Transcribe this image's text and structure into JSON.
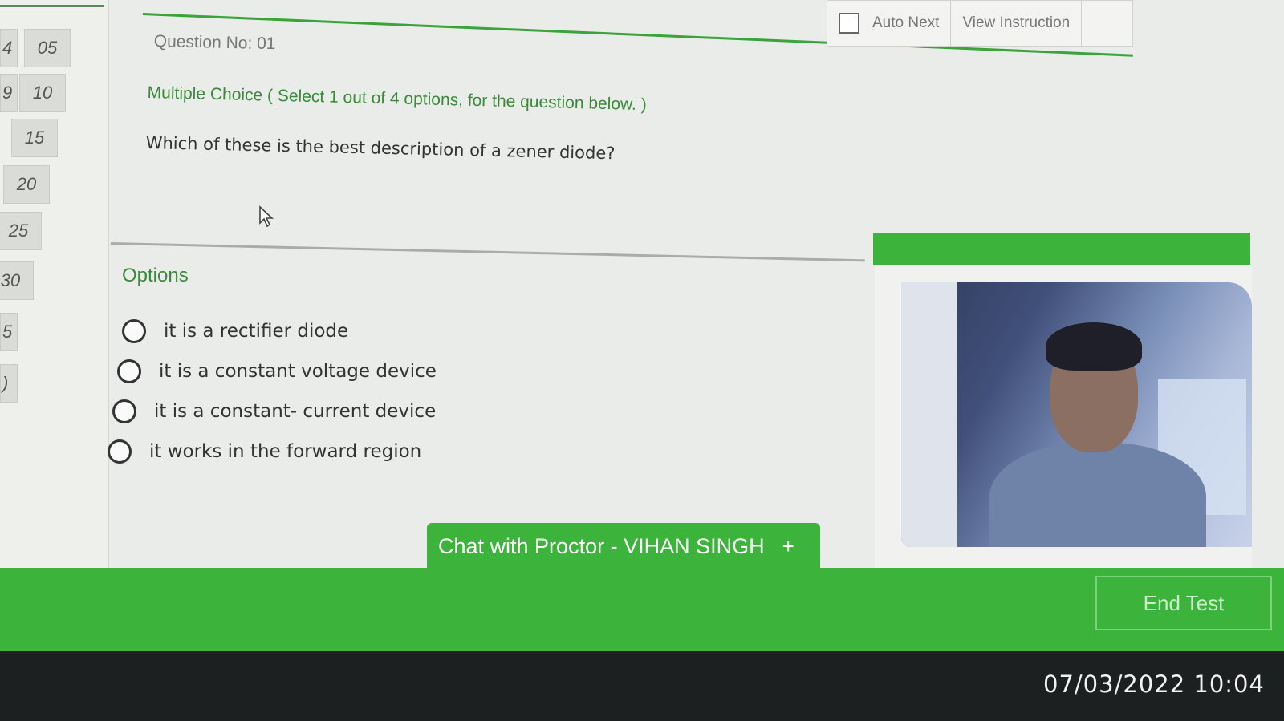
{
  "sidebar": {
    "numbers": [
      "4",
      "05",
      "9",
      "10",
      "15",
      "20",
      "25",
      "30",
      "5",
      ")"
    ]
  },
  "toolbar": {
    "auto_next_label": "Auto Next",
    "view_instruction_label": "View Instruction"
  },
  "question": {
    "number_label": "Question No: 01",
    "type_label": "Multiple Choice ( Select 1 out of 4 options, for the question below. )",
    "text": "Which of these is the best description of a zener diode?"
  },
  "options": {
    "heading": "Options",
    "items": [
      "it is a rectifier diode",
      "it is a constant voltage device",
      "it is a constant- current device",
      "it works in the forward region"
    ]
  },
  "proctor": {
    "chat_label": "Chat with Proctor - VIHAN SINGH",
    "chat_plus": "+"
  },
  "footer": {
    "end_test_label": "End Test"
  },
  "overlay": {
    "timestamp": "07/03/2022 10:04"
  },
  "colors": {
    "accent_green": "#3cb43c",
    "label_green": "#3a8a3a"
  }
}
